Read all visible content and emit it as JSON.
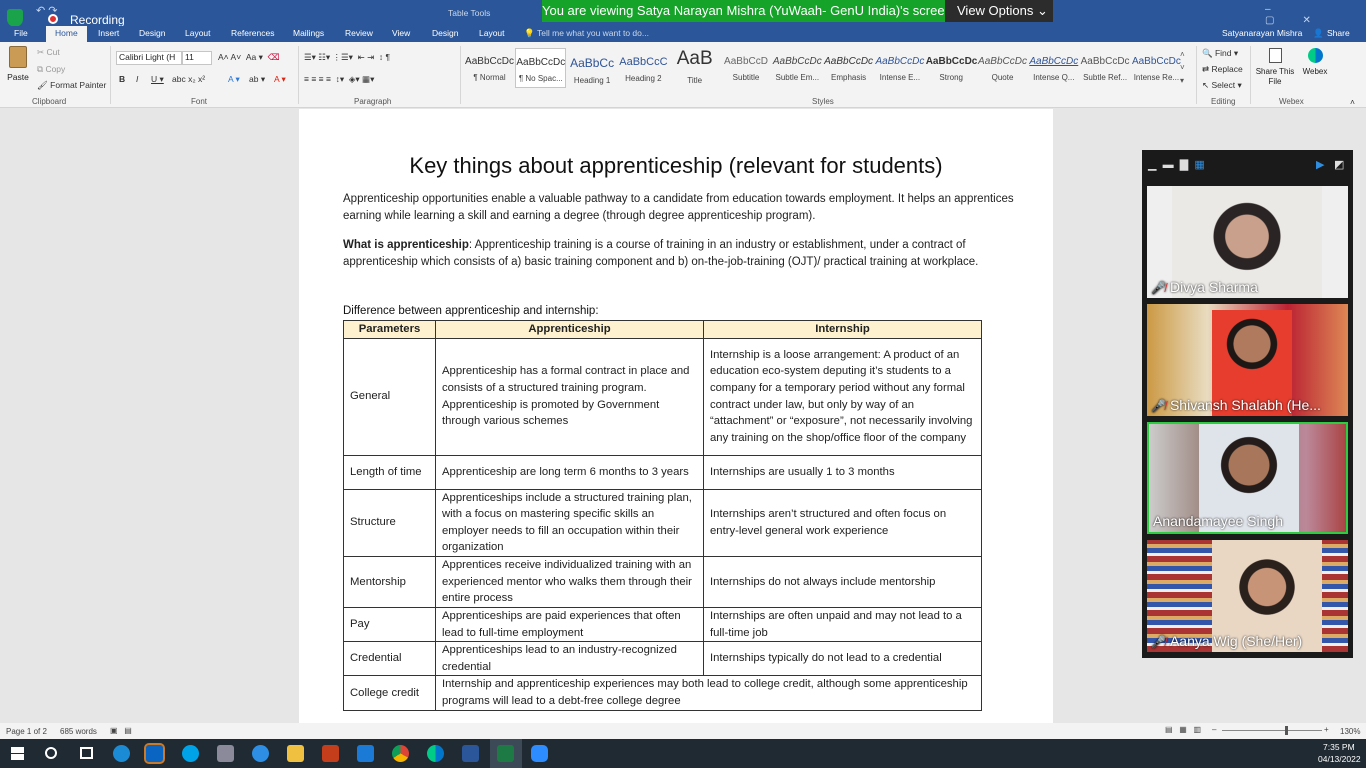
{
  "titlebar": {
    "recording": "Recording",
    "account": "Satyanarayan Mishra",
    "share": "Share"
  },
  "banner": {
    "text": "You are viewing Satya Narayan Mishra (YuWaah- GenU India)'s screen",
    "view_options": "View Options"
  },
  "tabs": [
    "File",
    "Home",
    "Insert",
    "Design",
    "Layout",
    "References",
    "Mailings",
    "Review",
    "View",
    "Design",
    "Layout"
  ],
  "table_tools": "Table Tools",
  "tell_me": "Tell me what you want to do...",
  "ribbon": {
    "clipboard": {
      "paste": "Paste",
      "cut": "Cut",
      "copy": "Copy",
      "format_painter": "Format Painter",
      "label": "Clipboard"
    },
    "font": {
      "name": "Calibri Light (H",
      "size": "11",
      "label": "Font"
    },
    "paragraph": {
      "label": "Paragraph"
    },
    "styles": {
      "label": "Styles",
      "items": [
        {
          "preview": "AaBbCcDc",
          "name": "¶ Normal"
        },
        {
          "preview": "AaBbCcDc",
          "name": "¶ No Spac..."
        },
        {
          "preview": "AaBbCc",
          "name": "Heading 1"
        },
        {
          "preview": "AaBbCcC",
          "name": "Heading 2"
        },
        {
          "preview": "AaB",
          "name": "Title"
        },
        {
          "preview": "AaBbCcD",
          "name": "Subtitle"
        },
        {
          "preview": "AaBbCcDc",
          "name": "Subtle Em..."
        },
        {
          "preview": "AaBbCcDc",
          "name": "Emphasis"
        },
        {
          "preview": "AaBbCcDc",
          "name": "Intense E..."
        },
        {
          "preview": "AaBbCcDc",
          "name": "Strong"
        },
        {
          "preview": "AaBbCcDc",
          "name": "Quote"
        },
        {
          "preview": "AaBbCcDc",
          "name": "Intense Q..."
        },
        {
          "preview": "AaBbCcDc",
          "name": "Subtle Ref..."
        },
        {
          "preview": "AaBbCcDc",
          "name": "Intense Re..."
        }
      ]
    },
    "editing": {
      "find": "Find",
      "replace": "Replace",
      "select": "Select",
      "label": "Editing"
    },
    "share_file": "Share This File",
    "webex": "Webex",
    "webex_label": "Webex"
  },
  "document": {
    "title": "Key things about apprenticeship (relevant for students)",
    "intro": "Apprenticeship opportunities enable a valuable pathway to a candidate from education towards employment. It helps an apprentices earning while learning a skill and earning a degree (through degree apprenticeship program).",
    "what_is_label": "What is apprenticeship",
    "what_is_text": ": Apprenticeship training is a course of training in an industry or establishment, under a contract of apprenticeship which consists of a) basic training component and b) on-the-job-training (OJT)/ practical training at workplace.",
    "diff_heading": "Difference between apprenticeship and internship:",
    "table": {
      "headers": [
        "Parameters",
        "Apprenticeship",
        "Internship"
      ],
      "rows": [
        {
          "param": "General",
          "app": "Apprenticeship has a formal contract in place and consists of a structured training program. Apprenticeship is promoted by Government through various schemes",
          "int": "Internship is a loose arrangement: A product of an education eco-system deputing it’s students to a company for a temporary period without any formal contract under law, but only by way of an “attachment” or “exposure”, not necessarily involving any training on the shop/office floor of the company"
        },
        {
          "param": "Length of time",
          "app": "Apprenticeship are long term 6 months to 3 years",
          "int": "Internships are usually 1 to 3 months"
        },
        {
          "param": "Structure",
          "app": "Apprenticeships include a structured training plan, with a focus on mastering specific skills an employer needs to fill an occupation within their organization",
          "int": "Internships aren’t structured and often focus on entry-level general work experience"
        },
        {
          "param": "Mentorship",
          "app": "Apprentices receive individualized training with an experienced mentor who walks them through their entire process",
          "int": "Internships do not always include mentorship"
        },
        {
          "param": "Pay",
          "app": "Apprenticeships are paid experiences that often lead to full-time employment",
          "int": "Internships are often unpaid and may not lead to a full-time job"
        },
        {
          "param": "Credential",
          "app": "Apprenticeships lead to an industry-recognized credential",
          "int": "Internships typically do not lead to a credential"
        }
      ],
      "last_row": {
        "param": "College credit",
        "text": "Internship and apprenticeship experiences may both lead to college credit, although some apprenticeship programs will lead to a debt-free college degree"
      }
    }
  },
  "status": {
    "page": "Page 1 of 2",
    "words": "685 words",
    "zoom": "130%"
  },
  "participants": [
    {
      "name": "Divya Sharma",
      "muted": true
    },
    {
      "name": "Shivansh Shalabh (He...",
      "muted": true
    },
    {
      "name": "Anandamayee Singh",
      "muted": false
    },
    {
      "name": "Aanya Wig (She/Her)",
      "muted": true
    }
  ],
  "taskbar": {
    "time": "7:35 PM",
    "date": "04/13/2022"
  },
  "colors": {
    "word_blue": "#2b579a",
    "banner_green": "#16a329",
    "header_fill": "#fdf1cf",
    "active_speaker": "#2ecc40"
  }
}
